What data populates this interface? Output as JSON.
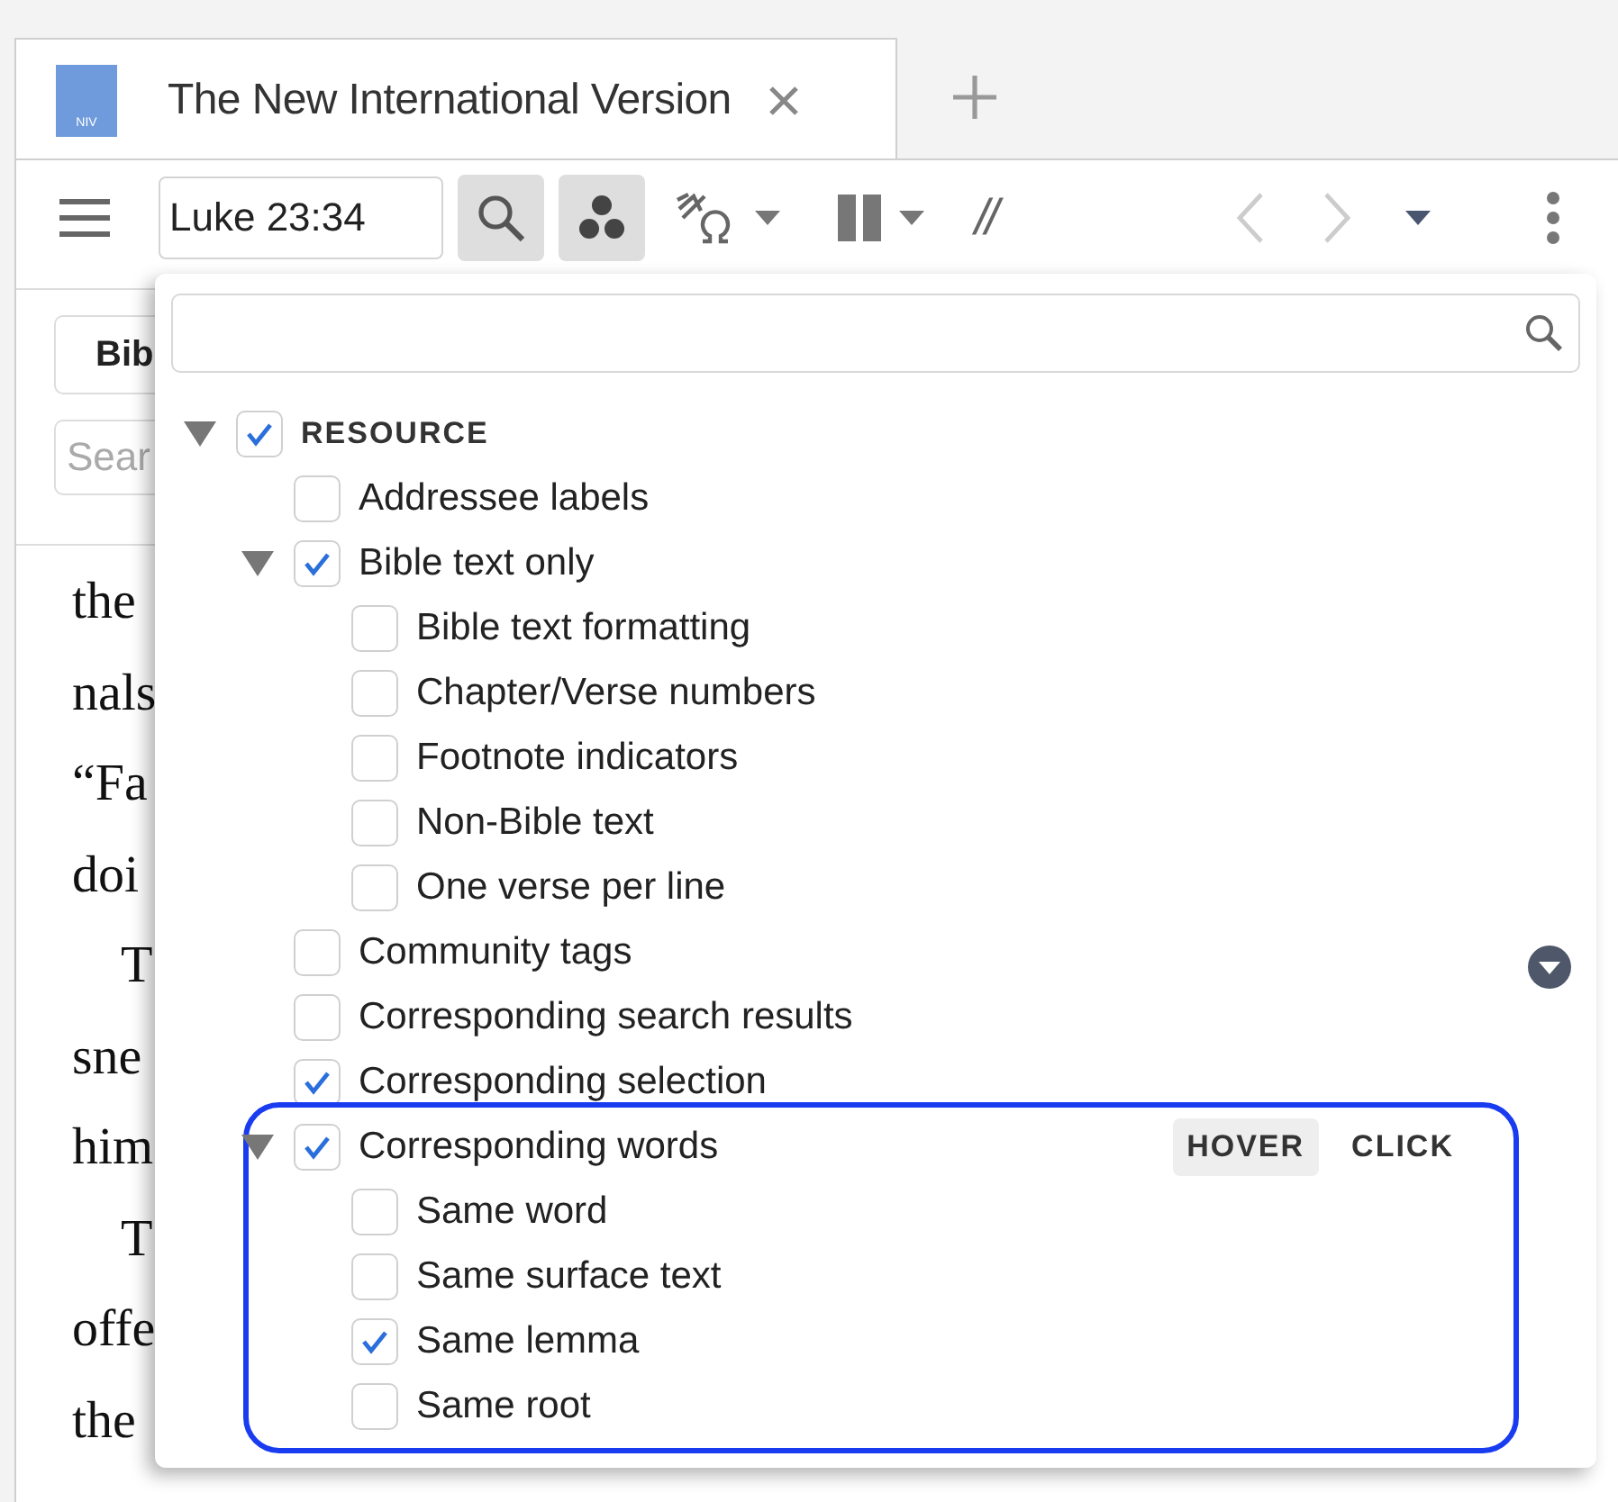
{
  "tab": {
    "badge": "NIV",
    "title": "The New International Version",
    "selected": true
  },
  "toolbar": {
    "reference": "Luke 23:34",
    "separator_label": "//"
  },
  "panel": {
    "button": "Bib",
    "search_placeholder": "Sear"
  },
  "reading": [
    {
      "text": "the",
      "indented": false
    },
    {
      "text": "nals",
      "indented": false
    },
    {
      "text": "“Fa",
      "indented": false
    },
    {
      "text": "doi",
      "indented": false
    },
    {
      "text": "T",
      "indented": true
    },
    {
      "text": "sne",
      "indented": false
    },
    {
      "text": "him",
      "indented": false
    },
    {
      "text": "T",
      "indented": true
    },
    {
      "text": "offe",
      "indented": false
    },
    {
      "text": "the",
      "indented": false
    }
  ],
  "popup": {
    "tree": [
      {
        "label": "RESOURCE",
        "checked": true,
        "expanded": true,
        "children": [
          {
            "label": "Addressee labels",
            "checked": false
          },
          {
            "label": "Bible text only",
            "checked": true,
            "expanded": true,
            "children": [
              {
                "label": "Bible text formatting",
                "checked": false
              },
              {
                "label": "Chapter/Verse numbers",
                "checked": false
              },
              {
                "label": "Footnote indicators",
                "checked": false
              },
              {
                "label": "Non-Bible text",
                "checked": false
              },
              {
                "label": "One verse per line",
                "checked": false
              }
            ]
          },
          {
            "label": "Community tags",
            "checked": false
          },
          {
            "label": "Corresponding search results",
            "checked": false
          },
          {
            "label": "Corresponding selection",
            "checked": true
          },
          {
            "label": "Corresponding words",
            "checked": true,
            "expanded": true,
            "highlighted": true,
            "modes": [
              {
                "label": "HOVER",
                "selected": true
              },
              {
                "label": "CLICK",
                "selected": false
              }
            ],
            "children": [
              {
                "label": "Same word",
                "checked": false
              },
              {
                "label": "Same surface text",
                "checked": false
              },
              {
                "label": "Same lemma",
                "checked": true
              },
              {
                "label": "Same root",
                "checked": false
              }
            ]
          }
        ]
      }
    ]
  }
}
